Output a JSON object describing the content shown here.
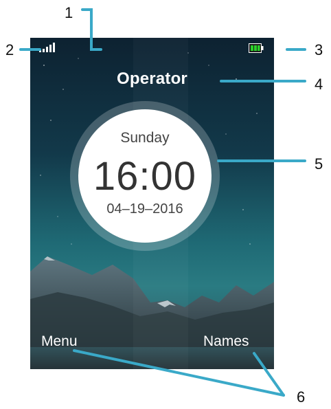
{
  "callouts": [
    "1",
    "2",
    "3",
    "4",
    "5",
    "6"
  ],
  "status_bar": {
    "signal_icon": "signal-strength-icon",
    "battery_icon": "battery-icon",
    "battery_color": "#2bd12b"
  },
  "operator_name": "Operator",
  "clock": {
    "day": "Sunday",
    "time": "16:00",
    "date": "04–19–2016"
  },
  "softkeys": {
    "left": "Menu",
    "right": "Names"
  },
  "colors": {
    "callout_line": "#3aa9c8",
    "sky_top": "#0d2231",
    "sky_mid": "#1f6a75"
  }
}
